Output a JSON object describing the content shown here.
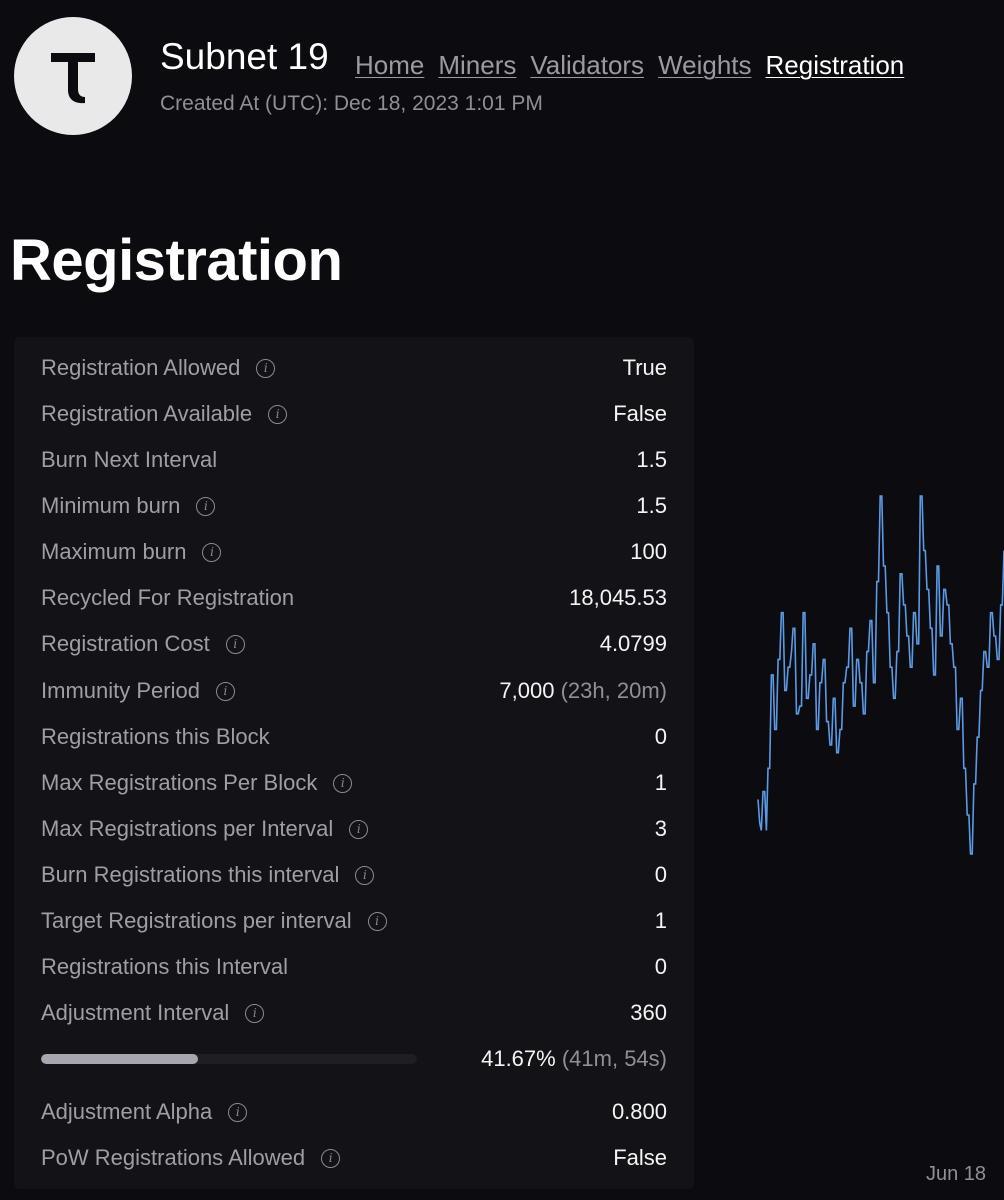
{
  "header": {
    "logo_letter": "T",
    "title": "Subnet 19",
    "created": "Created At (UTC): Dec 18, 2023 1:01 PM",
    "nav": [
      "Home",
      "Miners",
      "Validators",
      "Weights",
      "Registration"
    ],
    "active_nav": "Registration"
  },
  "page": {
    "heading": "Registration"
  },
  "rows": [
    {
      "label": "Registration Allowed",
      "value": "True",
      "info": true
    },
    {
      "label": "Registration Available",
      "value": "False",
      "info": true
    },
    {
      "label": "Burn Next Interval",
      "value": "1.5",
      "info": false
    },
    {
      "label": "Minimum burn",
      "value": "1.5",
      "info": true
    },
    {
      "label": "Maximum burn",
      "value": "100",
      "info": true
    },
    {
      "label": "Recycled For Registration",
      "value": "18,045.53",
      "info": false
    },
    {
      "label": "Registration Cost",
      "value": "4.0799",
      "info": true
    },
    {
      "label": "Immunity Period",
      "value": "7,000",
      "value_sub": "(23h, 20m)",
      "info": true
    },
    {
      "label": "Registrations this Block",
      "value": "0",
      "info": false
    },
    {
      "label": "Max Registrations Per Block",
      "value": "1",
      "info": true
    },
    {
      "label": "Max Registrations per Interval",
      "value": "3",
      "info": true
    },
    {
      "label": "Burn Registrations this interval",
      "value": "0",
      "info": true
    },
    {
      "label": "Target Registrations per interval",
      "value": "1",
      "info": true
    },
    {
      "label": "Registrations this Interval",
      "value": "0",
      "info": false
    },
    {
      "label": "Adjustment Interval",
      "value": "360",
      "info": true
    }
  ],
  "progress": {
    "percent": 41.67,
    "value": "41.67%",
    "value_sub": "(41m, 54s)"
  },
  "rows_after": [
    {
      "label": "Adjustment Alpha",
      "value": "0.800",
      "info": true
    },
    {
      "label": "PoW Registrations Allowed",
      "value": "False",
      "info": true
    }
  ],
  "chart_data": {
    "type": "line",
    "x_label_visible": "Jun 18",
    "color": "#5b9be6",
    "values": [
      0.22,
      0.16,
      0.14,
      0.24,
      0.24,
      0.14,
      0.3,
      0.3,
      0.54,
      0.54,
      0.4,
      0.4,
      0.58,
      0.58,
      0.7,
      0.7,
      0.5,
      0.5,
      0.56,
      0.56,
      0.6,
      0.66,
      0.66,
      0.44,
      0.44,
      0.46,
      0.46,
      0.7,
      0.7,
      0.48,
      0.48,
      0.54,
      0.54,
      0.62,
      0.62,
      0.4,
      0.4,
      0.52,
      0.52,
      0.58,
      0.58,
      0.42,
      0.42,
      0.36,
      0.36,
      0.48,
      0.48,
      0.34,
      0.34,
      0.4,
      0.4,
      0.52,
      0.52,
      0.56,
      0.56,
      0.66,
      0.66,
      0.46,
      0.46,
      0.58,
      0.58,
      0.52,
      0.52,
      0.44,
      0.44,
      0.6,
      0.6,
      0.68,
      0.68,
      0.52,
      0.52,
      0.78,
      0.78,
      1.0,
      1.0,
      0.82,
      0.82,
      0.7,
      0.7,
      0.56,
      0.56,
      0.48,
      0.48,
      0.6,
      0.6,
      0.8,
      0.8,
      0.72,
      0.72,
      0.64,
      0.64,
      0.56,
      0.56,
      0.7,
      0.7,
      0.62,
      0.62,
      1.0,
      1.0,
      0.86,
      0.86,
      0.76,
      0.76,
      0.66,
      0.66,
      0.54,
      0.54,
      0.82,
      0.82,
      0.64,
      0.64,
      0.76,
      0.76,
      0.72,
      0.72,
      0.62,
      0.62,
      0.56,
      0.56,
      0.4,
      0.4,
      0.48,
      0.48,
      0.3,
      0.3,
      0.18,
      0.18,
      0.08,
      0.08,
      0.26,
      0.26,
      0.38,
      0.38,
      0.5,
      0.5,
      0.6,
      0.6,
      0.56,
      0.56,
      0.7,
      0.7,
      0.64,
      0.64,
      0.58,
      0.58,
      0.72,
      0.72,
      0.86
    ]
  }
}
